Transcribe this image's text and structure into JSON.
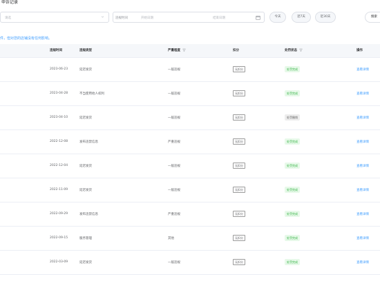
{
  "header": {
    "title": "申诉记录"
  },
  "filters": {
    "type_placeholder": "请选",
    "violation_time_label": "违规时间",
    "start_date": "开始日期",
    "end_date": "结束日期",
    "btn_today": "今天",
    "btn_7days": "近7天",
    "btn_30days": "近30天",
    "btn_right": "搜索"
  },
  "notice": "件，但对您的店铺没有任何影响。",
  "columns": {
    "time": "违规时间",
    "type": "违规类型",
    "severity": "严重程度",
    "penalty": "扣分",
    "appeal_status": "处罚状态",
    "op": "操作"
  },
  "rows": [
    {
      "time": "2023-06-23",
      "type": "延迟发货",
      "severity": "一般违规",
      "penalty": "无扣分",
      "status": "处罚完成",
      "status_type": "green",
      "op": "查看详情"
    },
    {
      "time": "2023-04-28",
      "type": "不当使用他人权利",
      "severity": "一般违规",
      "penalty": "无扣分",
      "status": "处罚完成",
      "status_type": "green",
      "op": "查看详情"
    },
    {
      "time": "2023-04-10",
      "type": "延迟发货",
      "severity": "一般违规",
      "penalty": "无扣分",
      "status": "处罚撤销",
      "status_type": "gray",
      "op": "查看详情"
    },
    {
      "time": "2022-12-08",
      "type": "发布违禁信息",
      "severity": "严重违规",
      "penalty": "无扣分",
      "status": "处罚完成",
      "status_type": "green",
      "op": "查看详情"
    },
    {
      "time": "2022-12-04",
      "type": "延迟发货",
      "severity": "一般违规",
      "penalty": "无扣分",
      "status": "处罚完成",
      "status_type": "green",
      "op": "查看详情"
    },
    {
      "time": "2022-11-09",
      "type": "延迟发货",
      "severity": "一般违规",
      "penalty": "无扣分",
      "status": "处罚完成",
      "status_type": "green",
      "op": "查看详情"
    },
    {
      "time": "2022-09-29",
      "type": "发布违禁信息",
      "severity": "严重违规",
      "penalty": "无扣分",
      "status": "处罚完成",
      "status_type": "green",
      "op": "查看详情"
    },
    {
      "time": "2022-09-15",
      "type": "服务管理",
      "severity": "其他",
      "penalty": "无扣分",
      "status": "处罚完成",
      "status_type": "green",
      "op": "查看详情"
    },
    {
      "time": "2022-03-09",
      "type": "延迟发货",
      "severity": "一般违规",
      "penalty": "无扣分",
      "status": "处罚完成",
      "status_type": "green",
      "op": "查看详情"
    }
  ],
  "colors": {
    "accent": "#409eff",
    "success_bg": "#e7f9e9",
    "success_fg": "#3bb54a"
  }
}
